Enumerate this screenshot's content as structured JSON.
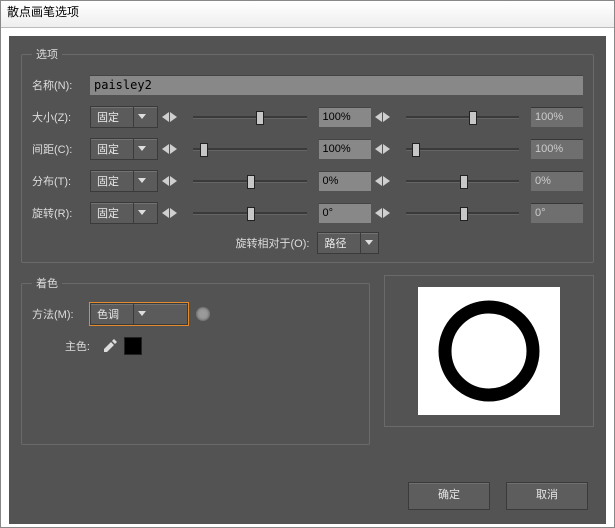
{
  "window": {
    "title": "散点画笔选项"
  },
  "groups": {
    "options": "选项",
    "color": "着色"
  },
  "labels": {
    "name": "名称(N):",
    "size": "大小(Z):",
    "spacing": "间距(C):",
    "scatter": "分布(T):",
    "rotation": "旋转(R):",
    "rotationRelativeTo": "旋转相对于(O):",
    "method": "方法(M):",
    "key": "主色:"
  },
  "dropdowns": {
    "size": "固定",
    "spacing": "固定",
    "scatter": "固定",
    "rotation": "固定",
    "rotationRel": "路径",
    "method": "色调"
  },
  "values": {
    "name": "paisley2",
    "size1": "100%",
    "size2": "100%",
    "spacing1": "100%",
    "spacing2": "100%",
    "scatter1": "0%",
    "scatter2": "0%",
    "rotation1": "0°",
    "rotation2": "0°"
  },
  "buttons": {
    "ok": "确定",
    "cancel": "取消"
  },
  "preview": {
    "shape": "ring",
    "stroke": "#000",
    "bg": "#fff"
  }
}
